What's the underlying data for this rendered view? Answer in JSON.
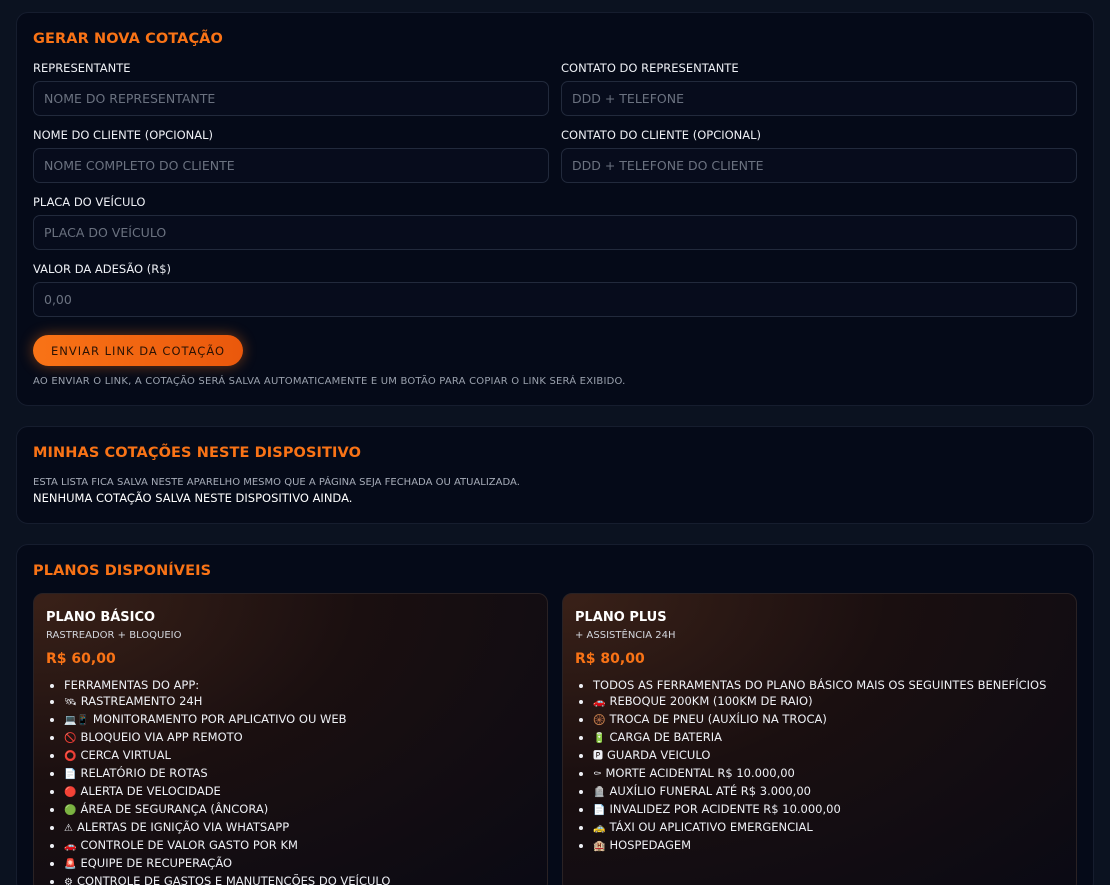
{
  "form": {
    "title": "GERAR NOVA COTAÇÃO",
    "rep_label": "REPRESENTANTE",
    "rep_placeholder": "NOME DO REPRESENTANTE",
    "rep_contact_label": "CONTATO DO REPRESENTANTE",
    "rep_contact_placeholder": "DDD + TELEFONE",
    "client_label": "NOME DO CLIENTE (OPCIONAL)",
    "client_placeholder": "NOME COMPLETO DO CLIENTE",
    "client_contact_label": "CONTATO DO CLIENTE (OPCIONAL)",
    "client_contact_placeholder": "DDD + TELEFONE DO CLIENTE",
    "plate_label": "PLACA DO VEÍCULO",
    "plate_placeholder": "PLACA DO VEÍCULO",
    "fee_label": "VALOR DA ADESÃO (R$)",
    "fee_placeholder": "0,00",
    "send_button": "ENVIAR LINK DA COTAÇÃO",
    "hint": "AO ENVIAR O LINK, A COTAÇÃO SERÁ SALVA AUTOMATICAMENTE E UM BOTÃO PARA COPIAR O LINK SERÁ EXIBIDO."
  },
  "saved": {
    "title": "MINHAS COTAÇÕES NESTE DISPOSITIVO",
    "description": "ESTA LISTA FICA SALVA NESTE APARELHO MESMO QUE A PÁGINA SEJA FECHADA OU ATUALIZADA.",
    "empty": "NENHUMA COTAÇÃO SALVA NESTE DISPOSITIVO AINDA."
  },
  "plans": {
    "title": "PLANOS DISPONÍVEIS",
    "basic": {
      "name": "PLANO BÁSICO",
      "subtitle": "RASTREADOR + BLOQUEIO",
      "price": "R$ 60,00",
      "features": [
        {
          "icon": "",
          "text": "FERRAMENTAS DO APP:"
        },
        {
          "icon": "🛰",
          "text": "RASTREAMENTO 24H"
        },
        {
          "icon": "💻📱",
          "text": "MONITORAMENTO POR APLICATIVO OU WEB"
        },
        {
          "icon": "🚫",
          "text": "BLOQUEIO VIA APP REMOTO"
        },
        {
          "icon": "⭕",
          "text": "CERCA VIRTUAL"
        },
        {
          "icon": "📄",
          "text": "RELATÓRIO DE ROTAS"
        },
        {
          "icon": "🔴",
          "text": "ALERTA DE VELOCIDADE"
        },
        {
          "icon": "🟢",
          "text": "ÁREA DE SEGURANÇA (ÂNCORA)"
        },
        {
          "icon": "⚠",
          "text": "ALERTAS DE IGNIÇÃO VIA WHATSAPP"
        },
        {
          "icon": "🚗",
          "text": "CONTROLE DE VALOR GASTO POR KM"
        },
        {
          "icon": "🚨",
          "text": "EQUIPE DE RECUPERAÇÃO"
        },
        {
          "icon": "⚙",
          "text": "CONTROLE DE GASTOS E MANUTENÇÕES DO VEÍCULO"
        }
      ]
    },
    "plus": {
      "name": "PLANO PLUS",
      "subtitle": "+ ASSISTÊNCIA 24H",
      "price": "R$ 80,00",
      "features": [
        {
          "icon": "",
          "text": "TODOS AS FERRAMENTAS DO PLANO BÁSICO MAIS OS SEGUINTES BENEFÍCIOS"
        },
        {
          "icon": "🚗",
          "text": "REBOQUE 200KM (100KM DE RAIO)"
        },
        {
          "icon": "🛞",
          "text": "TROCA DE PNEU (AUXÍLIO NA TROCA)"
        },
        {
          "icon": "🔋",
          "text": "CARGA DE BATERIA"
        },
        {
          "icon": "🅿",
          "text": "GUARDA VEICULO"
        },
        {
          "icon": "⚰",
          "text": "MORTE ACIDENTAL R$ 10.000,00"
        },
        {
          "icon": "🪦",
          "text": "AUXÍLIO FUNERAL ATÉ R$ 3.000,00"
        },
        {
          "icon": "📄",
          "text": "INVALIDEZ POR ACIDENTE R$ 10.000,00"
        },
        {
          "icon": "🚕",
          "text": "TÁXI OU APLICATIVO EMERGENCIAL"
        },
        {
          "icon": "🏨",
          "text": "HOSPEDAGEM"
        }
      ]
    }
  }
}
